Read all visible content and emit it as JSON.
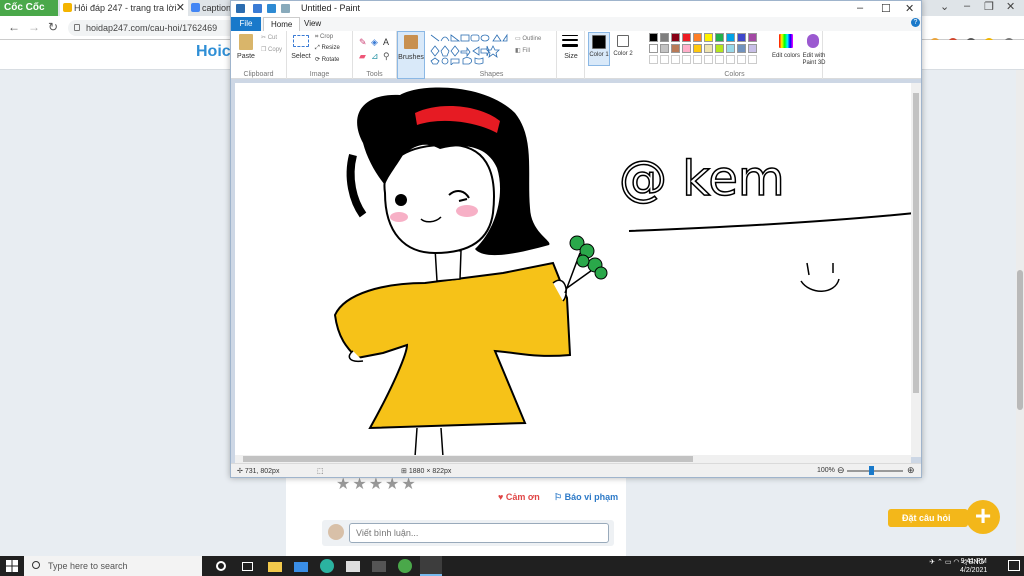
{
  "browser": {
    "brand_label": "Cốc Cốc",
    "tabs": [
      {
        "label": "Hỏi đáp 247 - trang tra lời"
      },
      {
        "label": "caption"
      }
    ],
    "url": "hoidap247.com/cau-hoi/1762469",
    "nav": {
      "back": "←",
      "forward": "→",
      "reload": "↻"
    },
    "controls": {
      "minimize": "–",
      "restore": "❐",
      "close": "✕"
    }
  },
  "site": {
    "logo": "Hoic",
    "stars": "★★★★★",
    "thanks_label": "Cảm ơn",
    "report_label": "Báo vi phạm",
    "comment_placeholder": "Viết bình luận...",
    "ask_button": "Đặt câu hỏi",
    "ask_plus": "+"
  },
  "paint": {
    "title": "Untitled - Paint",
    "file_tab": "File",
    "tabs": [
      "Home",
      "View"
    ],
    "controls": {
      "minimize": "–",
      "maximize": "☐",
      "close": "✕"
    },
    "help": "?",
    "groups": {
      "clipboard": {
        "label": "Clipboard",
        "paste": "Paste",
        "cut": "Cut",
        "copy": "Copy"
      },
      "image": {
        "label": "Image",
        "select": "Select",
        "crop": "Crop",
        "resize": "Resize",
        "rotate": "Rotate"
      },
      "tools": {
        "label": "Tools"
      },
      "brushes": {
        "label": "Brushes"
      },
      "shapes": {
        "label": "Shapes",
        "outline": "Outline",
        "fill": "Fill"
      },
      "size": {
        "label": "Size"
      },
      "colors": {
        "label": "Colors",
        "color1": "Color 1",
        "color2": "Color 2",
        "edit_colors": "Edit colors",
        "edit_with_3d": "Edit with Paint 3D"
      }
    },
    "palette": [
      "#000000",
      "#7f7f7f",
      "#880015",
      "#ed1c24",
      "#ff7f27",
      "#fff200",
      "#22b14c",
      "#00a2e8",
      "#3f48cc",
      "#a349a4",
      "#ffffff",
      "#c3c3c3",
      "#b97a57",
      "#ffaec9",
      "#ffc90e",
      "#efe4b0",
      "#b5e61d",
      "#99d9ea",
      "#7092be",
      "#c8bfe7"
    ],
    "canvas_text": "@ kem",
    "status": {
      "cursor": "731, 802px",
      "size": "1880 × 822px",
      "zoom": "100%"
    }
  },
  "taskbar": {
    "search_placeholder": "Type here to search",
    "lang": "ENG",
    "time": "9:41 PM",
    "date": "4/2/2021"
  }
}
